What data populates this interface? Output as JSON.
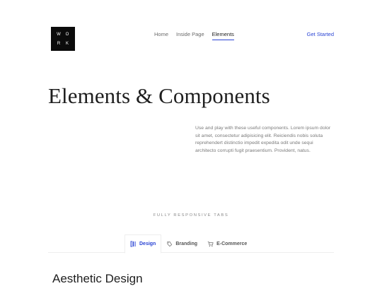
{
  "header": {
    "logo_letters": [
      "W",
      "O",
      "R",
      "K"
    ],
    "nav": [
      {
        "label": "Home"
      },
      {
        "label": "Inside Page"
      },
      {
        "label": "Elements",
        "active": true
      }
    ],
    "cta_label": "Get Started"
  },
  "hero": {
    "title": "Elements & Components",
    "text": "Use and play with these useful components. Lorem ipsum dolor sit amet, consectetur adipisicing elit. Reiciendis nobis soluta reprehendert distinctio impedit expedita odit unde sequi architecto corrupti fugit praesentium. Provident, natus."
  },
  "tabs_section": {
    "label": "FULLY RESPONSIVE TABS",
    "tabs": [
      {
        "label": "Design",
        "icon": "design-icon",
        "active": true
      },
      {
        "label": "Branding",
        "icon": "branding-icon"
      },
      {
        "label": "E-Commerce",
        "icon": "cart-icon"
      }
    ],
    "panel_title": "Aesthetic Design"
  },
  "colors": {
    "accent": "#2a44d4",
    "logo_bg": "#0b0b0b"
  }
}
